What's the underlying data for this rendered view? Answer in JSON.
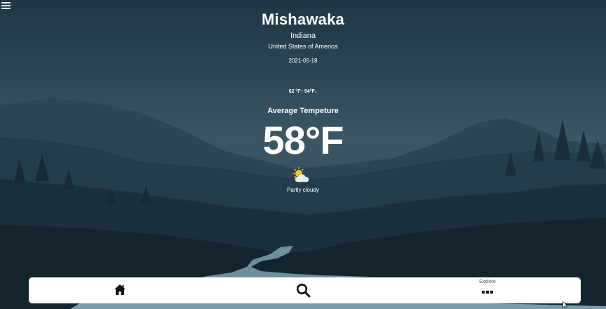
{
  "location": {
    "city": "Mishawaka",
    "state": "Indiana",
    "country": "United States of America"
  },
  "date": "2021-05-18",
  "high_low": "62 °F↑ 54°F↓",
  "average_label": "Average Tempeture",
  "average_temp": "58°F",
  "condition": {
    "text": "Partly cloudy",
    "icon": "partly-cloudy-icon"
  },
  "nav": {
    "home_icon": "home-icon",
    "search_icon": "search-icon",
    "explore_label": "Explore",
    "explore_icon": "more-dots-icon"
  },
  "menu_icon": "hamburger-menu-icon",
  "colors": {
    "sky": "#3a5563",
    "mountains_far": "#2d4856",
    "forest": "#1a2c38",
    "river": "#8fb0bd",
    "nav_background": "#ffffff"
  }
}
